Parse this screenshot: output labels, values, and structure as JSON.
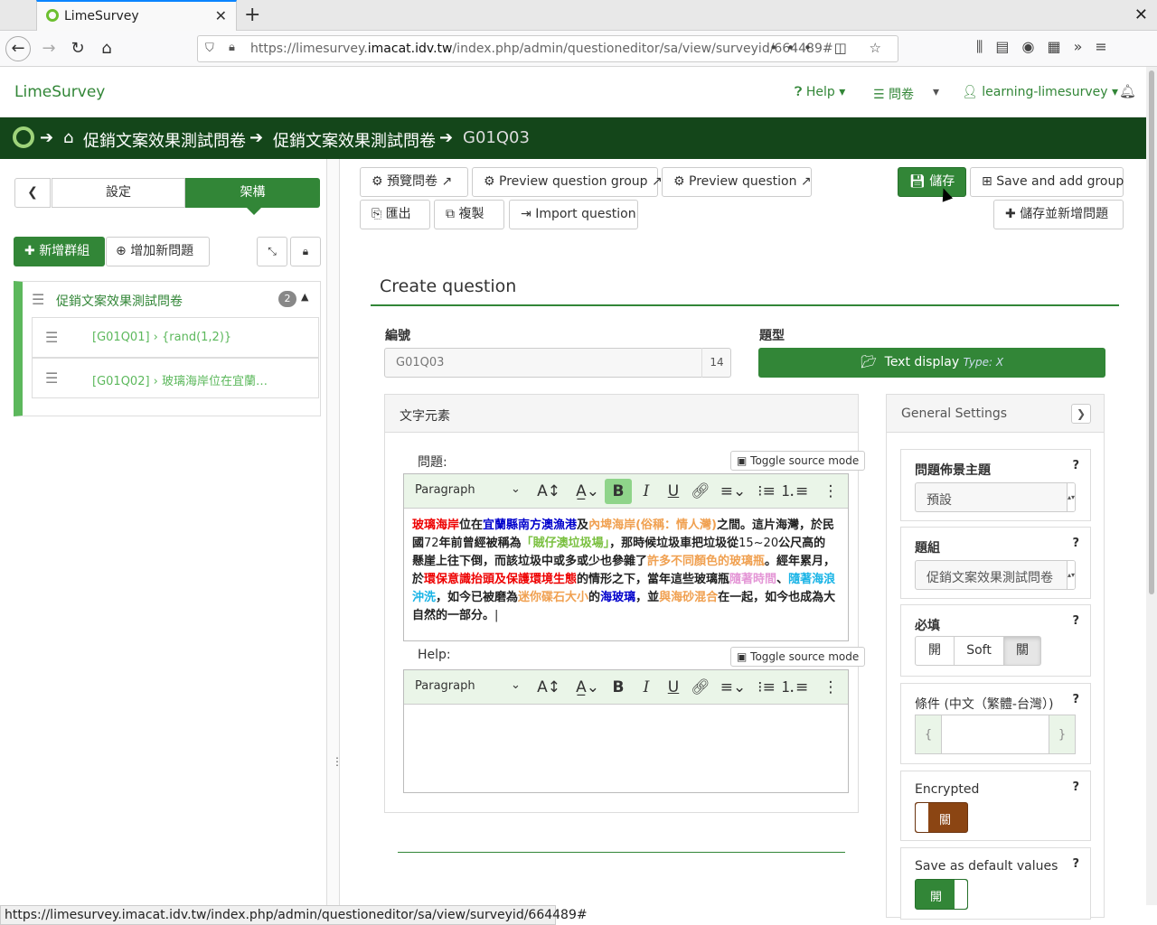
{
  "browser": {
    "tab_title": "LimeSurvey",
    "url_pre": "https://limesurvey.",
    "url_host": "imacat.idv.tw",
    "url_post": "/index.php/admin/questioneditor/sa/view/surveyid/664489#",
    "status_url": "https://limesurvey.imacat.idv.tw/index.php/admin/questioneditor/sa/view/surveyid/664489#"
  },
  "appnav": {
    "brand": "LimeSurvey",
    "help": "Help",
    "surveys": "問卷",
    "user": "learning-limesurvey"
  },
  "breadcrumb": {
    "survey": "促銷文案效果測試問卷",
    "group": "促銷文案效果測試問卷",
    "question": "G01Q03"
  },
  "sidebar": {
    "tab_settings": "設定",
    "tab_structure": "架構",
    "add_group": "新增群組",
    "add_question": "增加新問題",
    "group_name": "促銷文案效果測試問卷",
    "group_count": "2",
    "questions": [
      "[G01Q01] › {rand(1,2)}",
      "[G01Q02] › 玻璃海岸位在宜蘭…"
    ]
  },
  "toolbar": {
    "preview_survey": "預覽問卷",
    "preview_group": "Preview question group",
    "preview_question": "Preview question",
    "save": "儲存",
    "save_add_group": "Save and add group",
    "export": "匯出",
    "copy": "複製",
    "import_question": "Import question",
    "save_add_question": "儲存並新增問題"
  },
  "form": {
    "heading": "Create question",
    "code_label": "編號",
    "code_value": "G01Q03",
    "code_count": "14",
    "type_label": "題型",
    "type_value": "Text display",
    "type_code": "Type: X"
  },
  "text_panel": {
    "title": "文字元素",
    "question_label": "問題:",
    "help_label": "Help:",
    "toggle_source": "Toggle source mode",
    "paragraph": "Paragraph",
    "question_segments": [
      {
        "t": "玻璃海岸",
        "c": "c-red"
      },
      {
        "t": "位在",
        "c": ""
      },
      {
        "t": "宜蘭縣南方澳漁港",
        "c": "c-blue"
      },
      {
        "t": "及",
        "c": ""
      },
      {
        "t": "內埤海岸(俗稱：情人灣)",
        "c": "c-orange"
      },
      {
        "t": "之間。這片海灣，於民國",
        "c": ""
      },
      {
        "t": "72",
        "c": "c-norm"
      },
      {
        "t": "年前曾經被稱為",
        "c": ""
      },
      {
        "t": "「賊仔澳垃圾場」",
        "c": "c-green"
      },
      {
        "t": "，那時候垃圾車把垃圾從",
        "c": ""
      },
      {
        "t": "15~20",
        "c": "c-norm"
      },
      {
        "t": "公尺高的懸崖上往下倒，而該垃圾中或多或少也參雜了",
        "c": ""
      },
      {
        "t": "許多不同顏色的玻璃瓶",
        "c": "c-orange"
      },
      {
        "t": "。經年累月，於",
        "c": ""
      },
      {
        "t": "環保意識抬頭及保護環境生態",
        "c": "c-red"
      },
      {
        "t": "的情形之下，當年這些玻璃瓶",
        "c": ""
      },
      {
        "t": "隨著時間",
        "c": "c-pink"
      },
      {
        "t": "、",
        "c": ""
      },
      {
        "t": "隨著海浪沖洗",
        "c": "c-cyan"
      },
      {
        "t": "，如今已被磨為",
        "c": ""
      },
      {
        "t": "迷你碟石大小",
        "c": "c-orange"
      },
      {
        "t": "的",
        "c": ""
      },
      {
        "t": "海玻璃",
        "c": "c-blue"
      },
      {
        "t": "，並",
        "c": ""
      },
      {
        "t": "與海砂混合",
        "c": "c-orange"
      },
      {
        "t": "在一起，如今也成為大自然的一部分。",
        "c": ""
      }
    ]
  },
  "general_settings": {
    "title": "General Settings",
    "theme_label": "問題佈景主題",
    "theme_value": "預設",
    "group_label": "題組",
    "group_value": "促銷文案效果測試問卷",
    "mandatory_label": "必填",
    "mandatory_on": "開",
    "mandatory_soft": "Soft",
    "mandatory_off": "關",
    "condition_label": "條件 (中文（繁體-台灣）)",
    "condition_open": "{",
    "condition_close": "}",
    "encrypted_label": "Encrypted",
    "encrypted_value": "關",
    "default_label": "Save as default values",
    "default_value": "開"
  }
}
